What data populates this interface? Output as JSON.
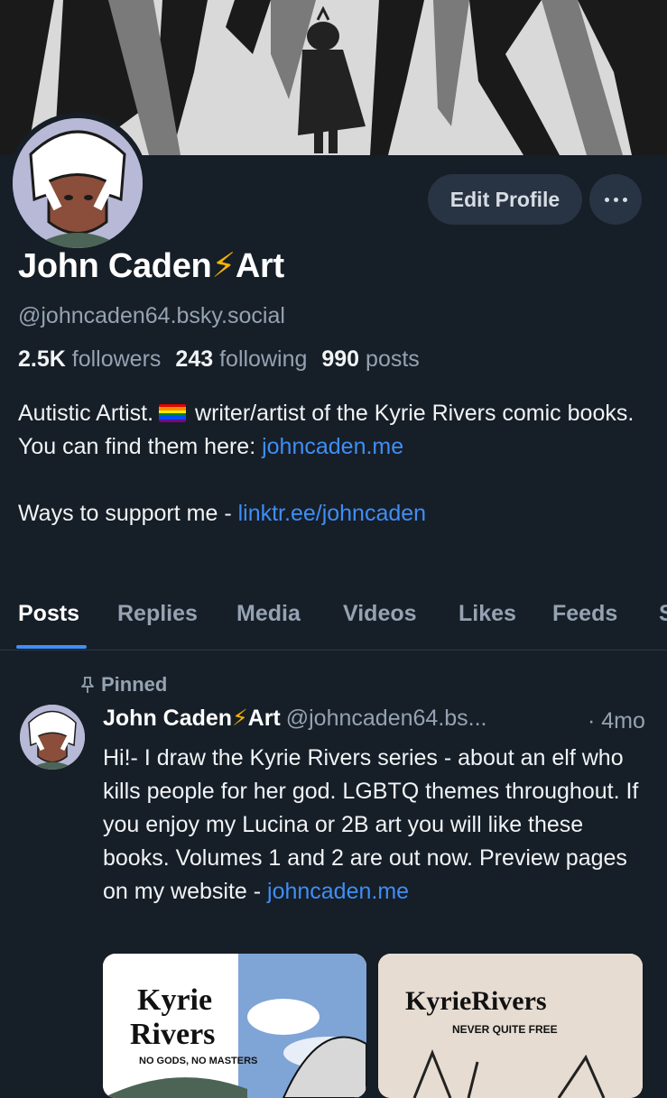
{
  "profile": {
    "display_name": "John Caden",
    "name_emoji": "⚡",
    "name_suffix": "Art",
    "handle": "@johncaden64.bsky.social",
    "edit_label": "Edit Profile",
    "more_label": "More options",
    "stats": {
      "followers_count": "2.5K",
      "followers_label": "followers",
      "following_count": "243",
      "following_label": "following",
      "posts_count": "990",
      "posts_label": "posts"
    },
    "bio": {
      "line1_a": "Autistic Artist.",
      "line1_b": "writer/artist of the Kyrie Rivers comic books.",
      "line2": "You can find them here: ",
      "link1": "johncaden.me",
      "line3": "Ways to support me - ",
      "link2": "linktr.ee/johncaden"
    }
  },
  "tabs": [
    "Posts",
    "Replies",
    "Media",
    "Videos",
    "Likes",
    "Feeds",
    "S"
  ],
  "active_tab": "Posts",
  "post": {
    "pinned_label": "Pinned",
    "author_name": "John Caden",
    "author_emoji": "⚡",
    "author_suffix": "Art",
    "author_handle": "@johncaden64.bs...",
    "time": "· 4mo",
    "text": "Hi!- I draw the Kyrie Rivers series - about an elf who kills people for her god.  LGBTQ themes throughout.  If you enjoy my Lucina or 2B art you will like these books. Volumes 1 and 2 are out now. Preview pages on my website  - ",
    "link": "johncaden.me",
    "images": [
      {
        "title_1": "Kyrie",
        "title_2": "Rivers",
        "subtitle": "NO GODS, NO MASTERS"
      },
      {
        "title": "KyrieRivers",
        "subtitle": "NEVER QUITE FREE"
      }
    ]
  },
  "colors": {
    "background": "#161e27",
    "accent_link": "#3f8ef6",
    "muted_text": "#95a2b2",
    "button_bg": "#283443"
  }
}
